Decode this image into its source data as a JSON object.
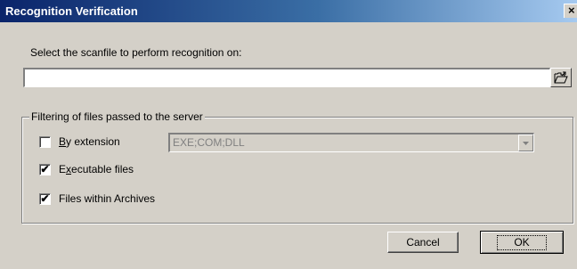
{
  "window": {
    "title": "Recognition Verification",
    "close_glyph": "×"
  },
  "scanfile": {
    "prompt": "Select the scanfile to perform recognition on:",
    "value": "",
    "browse_icon": "open-folder-icon"
  },
  "filter_group": {
    "legend": "Filtering of files passed to the server",
    "by_extension": {
      "label_accel": "B",
      "label_rest": "y extension",
      "checked": false
    },
    "extensions_combo": {
      "value": "EXE;COM;DLL",
      "enabled": false
    },
    "executable": {
      "label_pre": "E",
      "label_accel": "x",
      "label_rest": "ecutable files",
      "checked": true
    },
    "archives": {
      "label": "Files within Archives",
      "checked": true
    }
  },
  "buttons": {
    "cancel": "Cancel",
    "ok": "OK"
  },
  "glyphs": {
    "check": "✔"
  }
}
